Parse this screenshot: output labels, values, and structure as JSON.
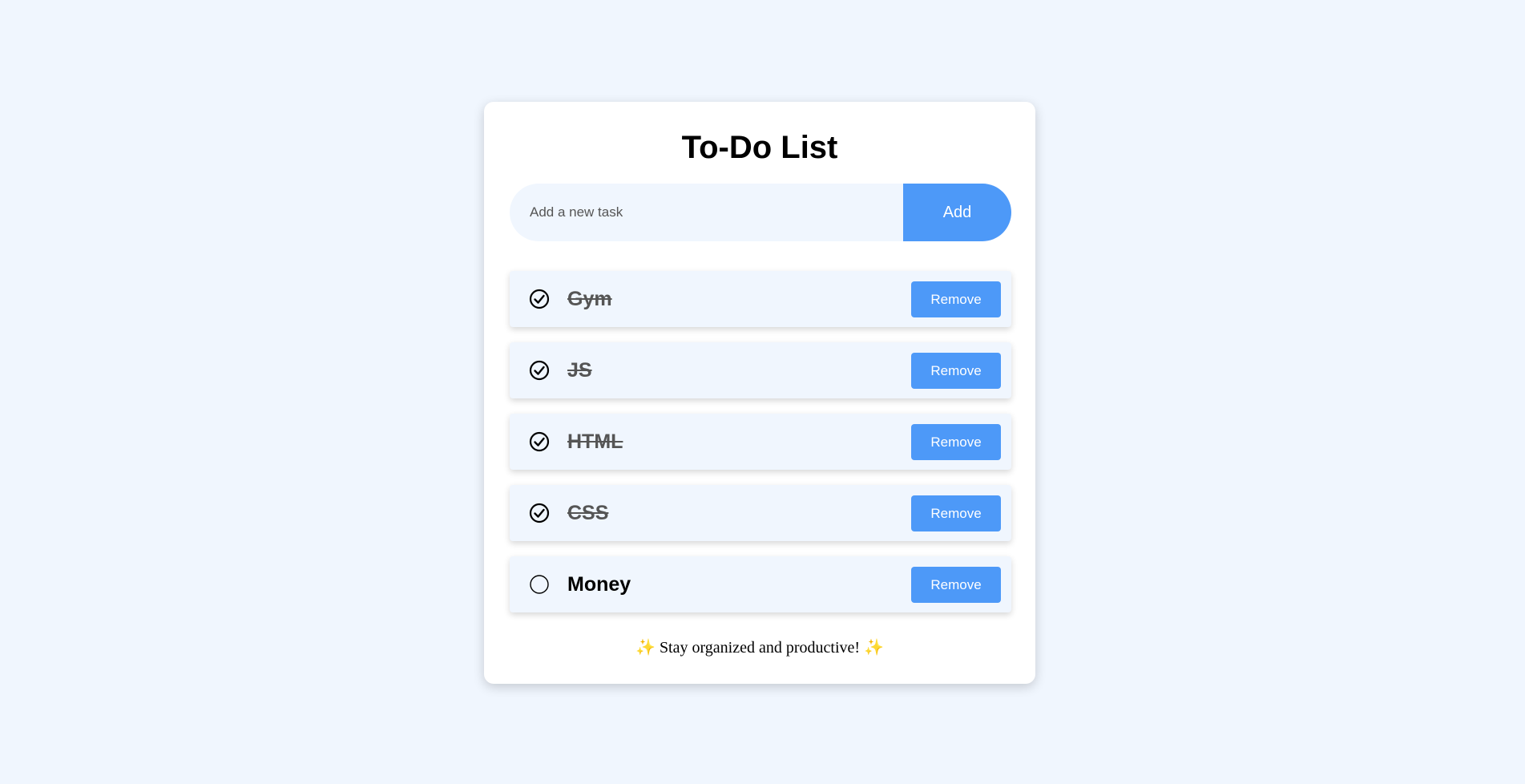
{
  "app": {
    "title": "To-Do List"
  },
  "input": {
    "placeholder": "Add a new task",
    "value": ""
  },
  "add_button": {
    "label": "Add"
  },
  "tasks": [
    {
      "text": "Gym",
      "done": true,
      "remove_label": "Remove"
    },
    {
      "text": "JS",
      "done": true,
      "remove_label": "Remove"
    },
    {
      "text": "HTML",
      "done": true,
      "remove_label": "Remove"
    },
    {
      "text": "CSS",
      "done": true,
      "remove_label": "Remove"
    },
    {
      "text": "Money",
      "done": false,
      "remove_label": "Remove"
    }
  ],
  "footer": {
    "text": "Stay organized and productive!",
    "icon": "sparkles-icon"
  },
  "colors": {
    "background": "#f0f6fe",
    "accent": "#4d99f8",
    "card": "#ffffff",
    "sparkle": "#f4b400"
  }
}
